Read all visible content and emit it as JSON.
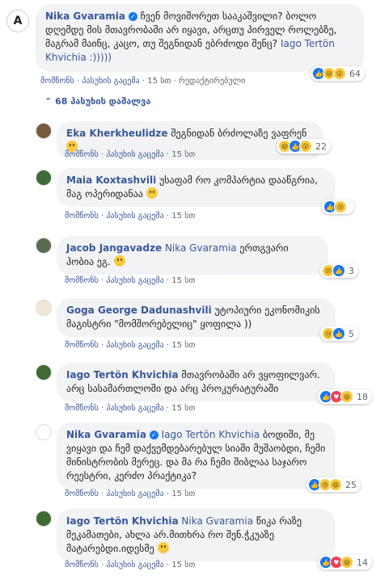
{
  "icons": {
    "verified": "verified-check-icon",
    "collapse": "chevron-up-icon"
  },
  "colors": {
    "link": "#385898",
    "bubble": "#f2f3f5",
    "like": "#1877f2",
    "love": "#f33e58",
    "emoji": "#f7c940"
  },
  "main_comment": {
    "author": "Nika Gvaramia",
    "text": "ჩვენ მოვიშორეთ სააკაშვილი? ბოლო დღემდე მის მთავრობაში არ იყავი, არცთუ პირველ როლებზე, მაგრამ მაინც, კაცო, თუ შეგნიდან ებრძოდი შენც?",
    "mention": "Iago Tertön Khvichia",
    "suffix": " :)))))",
    "like_label": "მომწონს",
    "reply_label": "პასუხის გაცემა",
    "time": "15 სთ",
    "edited_label": "რედაქტირებული",
    "reactions": {
      "icons": [
        "like",
        "haha",
        "wow"
      ],
      "count": "64"
    }
  },
  "replies_toggle": "68 პასუხის დამალვა",
  "replies": [
    {
      "author": "Eka Kherkheulidze",
      "text": "შეგნიდან ბრძოლაზე ვაფრენ",
      "emoji": true,
      "like_label": "მომწონს",
      "reply_label": "პასუხის გაცემა",
      "time": "15 სთ",
      "reactions": {
        "icons": [
          "haha",
          "like",
          "wow"
        ],
        "count": "22"
      }
    },
    {
      "author": "Maia Koxtashvili",
      "text": "უსაფამ რო კომპარტია დააწგრია, მაგ ოპერიდანაა",
      "emoji": true,
      "like_label": "მომწონს",
      "reply_label": "პასუხის გაცემა",
      "time": "15 სთ",
      "reactions": {
        "icons": [
          "like",
          "sad"
        ],
        "count": ""
      }
    },
    {
      "author": "Jacob Jangavadze",
      "mention": "Nika Gvaramia",
      "text": "ერთგვარი ჰობია ეგ.",
      "emoji": true,
      "like_label": "მომწონს",
      "reply_label": "პასუხის გაცემა",
      "time": "15 სთ",
      "reactions": {
        "icons": [
          "sad",
          "like"
        ],
        "count": "3"
      }
    },
    {
      "author": "Goga George Dadunashvili",
      "text": "უტოპიური ეკონომიკის მაგისტრი \"მომშორებელიც\" ყოფილა ))",
      "like_label": "მომწონს",
      "reply_label": "პასუხის გაცემა",
      "time": "15 სთ",
      "reactions": {
        "icons": [
          "sad",
          "like"
        ],
        "count": "5"
      }
    },
    {
      "author": "Iago Tertön Khvichia",
      "text": "მთავრობაში არ ვყოფილვარ. არც სასამართლოში და არც პროკურატურაში",
      "like_label": "მომწონს",
      "reply_label": "პასუხის გაცემა",
      "time": "15 სთ",
      "reactions": {
        "icons": [
          "like",
          "love",
          "haha"
        ],
        "count": "18"
      }
    },
    {
      "author": "Nika Gvaramia",
      "verified": true,
      "mention": "Iago Tertön Khvichia",
      "text": "ბოდიში, მე ვიყავი და ჩემ დაქვემდებარებულ სიაში მუშაობდი, ჩემი მინისტრობის მერეც. და მა რა ჩემი შიბლაა საჯარო რეესტრი, კერძო პრაქტიკა?",
      "like_label": "მომწონს",
      "reply_label": "პასუხის გაცემა",
      "time": "15 სთ",
      "reactions": {
        "icons": [
          "like",
          "sad",
          "haha"
        ],
        "count": "25"
      }
    },
    {
      "author": "Iago Tertön Khvichia",
      "mention": "Nika Gvaramia",
      "text": "წიკა რაზე მეკამათები, ახლა არ.მითხრა რო შენ.ჭკუაზე მატარებდი.იდესმე",
      "emoji": true,
      "like_label": "მომწონს",
      "reply_label": "პასუხის გაცემა",
      "time": "15 სთ",
      "reactions": {
        "icons": [
          "like",
          "love",
          "haha"
        ],
        "count": "14"
      }
    }
  ]
}
